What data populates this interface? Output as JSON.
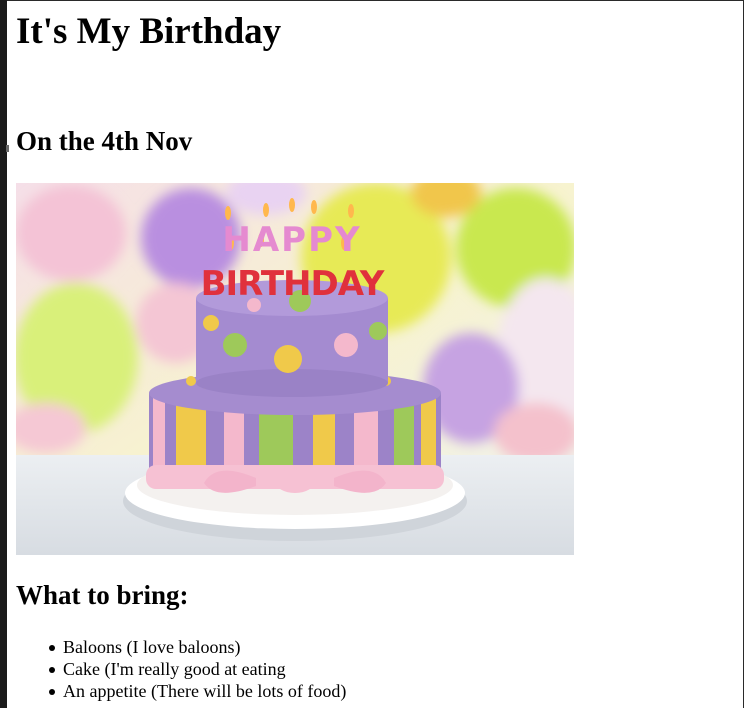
{
  "page": {
    "title": "It's My Birthday",
    "date_heading": "On the 4th Nov",
    "bring_heading": "What to bring:",
    "bring_items": [
      "Baloons (I love baloons)",
      "Cake (I'm really good at eating",
      "An appetite (There will be lots of food)"
    ]
  },
  "image": {
    "subject": "birthday cake photo",
    "cake_lettering": {
      "line1": "HAPPY",
      "line2": "BIRTHDAY"
    },
    "colors": {
      "cake_top": "#9c83c8",
      "ribbon": "#f4b8cc",
      "stripe_yellow": "#f0c94a",
      "stripe_green": "#9ec95a",
      "balloon_yellow": "#e6ef62",
      "balloon_purple": "#b98fe0"
    }
  }
}
